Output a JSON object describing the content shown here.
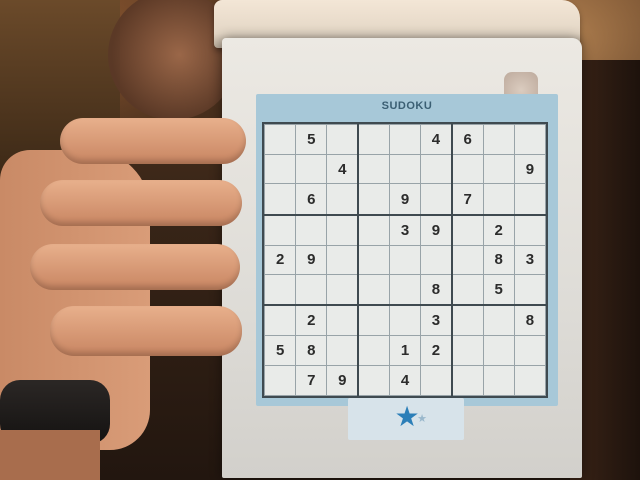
{
  "scene": {
    "description_label": "",
    "puzzle": {
      "title": "SUDOKU",
      "grid": [
        [
          "",
          "5",
          "",
          "",
          "",
          "4",
          "6",
          "",
          ""
        ],
        [
          "",
          "",
          "4",
          "",
          "",
          "",
          "",
          "",
          "9"
        ],
        [
          "",
          "6",
          "",
          "",
          "9",
          "",
          "7",
          "",
          ""
        ],
        [
          "",
          "",
          "",
          "",
          "3",
          "9",
          "",
          "2",
          ""
        ],
        [
          "2",
          "9",
          "",
          "",
          "",
          "",
          "",
          "8",
          "3"
        ],
        [
          "",
          "",
          "",
          "",
          "",
          "8",
          "",
          "5",
          ""
        ],
        [
          "",
          "2",
          "",
          "",
          "",
          "3",
          "",
          "",
          "8"
        ],
        [
          "5",
          "8",
          "",
          "",
          "1",
          "2",
          "",
          "",
          ""
        ],
        [
          "",
          "7",
          "9",
          "",
          "4",
          "",
          "",
          "",
          ""
        ]
      ],
      "rating_icon": "star-icon",
      "accent_color": "#2c7fb8",
      "panel_color": "#a7c8d8"
    }
  }
}
